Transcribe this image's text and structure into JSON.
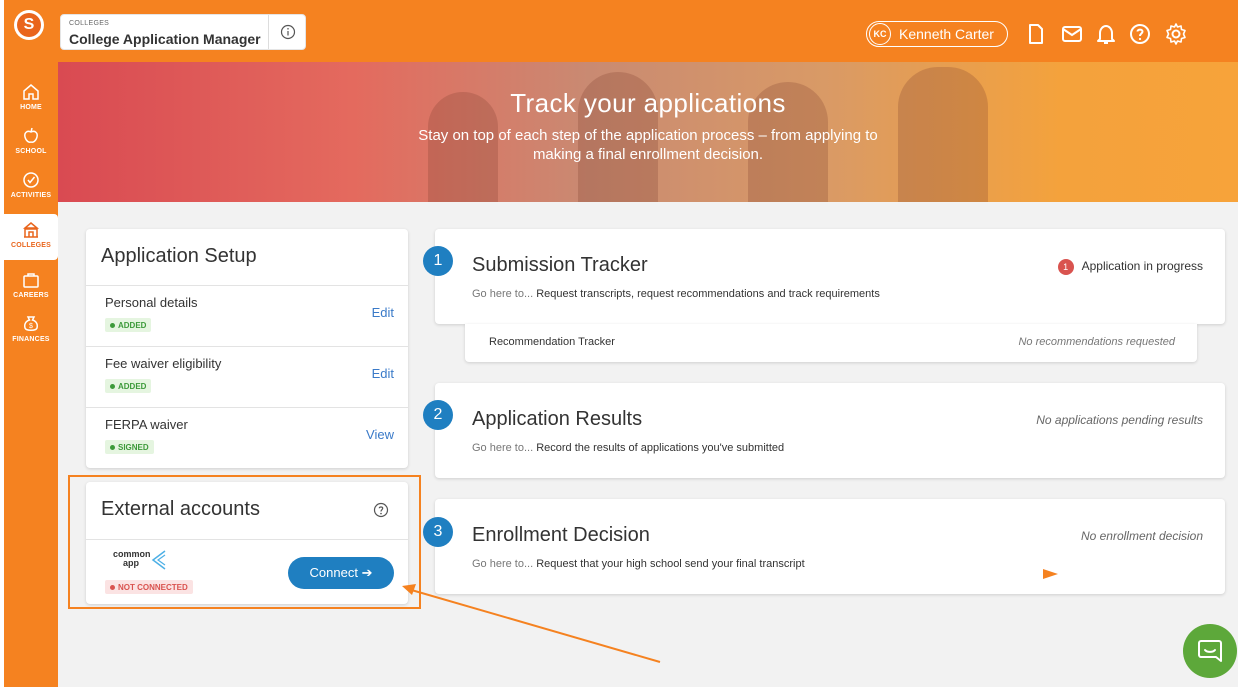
{
  "rail": {
    "logo": "S",
    "items": [
      {
        "label": "HOME",
        "icon": "home-icon"
      },
      {
        "label": "SCHOOL",
        "icon": "apple-icon"
      },
      {
        "label": "ACTIVITIES",
        "icon": "check-circle-icon"
      },
      {
        "label": "COLLEGES",
        "icon": "college-icon"
      },
      {
        "label": "CAREERS",
        "icon": "briefcase-icon"
      },
      {
        "label": "FINANCES",
        "icon": "money-bag-icon"
      }
    ]
  },
  "header": {
    "section_label": "COLLEGES",
    "title": "College Application Manager",
    "user_initials": "KC",
    "user_name": "Kenneth Carter"
  },
  "hero": {
    "title": "Track your applications",
    "subtitle": "Stay on top of each step of the application process – from applying to making a final enrollment decision."
  },
  "setup": {
    "title": "Application Setup",
    "rows": [
      {
        "label": "Personal details",
        "badge": "ADDED",
        "action": "Edit"
      },
      {
        "label": "Fee waiver eligibility",
        "badge": "ADDED",
        "action": "Edit"
      },
      {
        "label": "FERPA waiver",
        "badge": "SIGNED",
        "action": "View"
      }
    ]
  },
  "external": {
    "title": "External accounts",
    "logo_line1": "common",
    "logo_line2": "app",
    "badge": "NOT CONNECTED",
    "connect": "Connect ➔"
  },
  "trackers": [
    {
      "num": "1",
      "title": "Submission Tracker",
      "prefix": "Go here to...",
      "desc": "Request transcripts, request recommendations and track requirements",
      "count": "1",
      "status": "Application in progress"
    },
    {
      "num": "2",
      "title": "Application Results",
      "prefix": "Go here to...",
      "desc": "Record the results of applications you've submitted",
      "status": "No applications pending results"
    },
    {
      "num": "3",
      "title": "Enrollment Decision",
      "prefix": "Go here to...",
      "desc": "Request that your high school send your final transcript",
      "status": "No enrollment decision"
    }
  ],
  "recommendation": {
    "label": "Recommendation Tracker",
    "status": "No recommendations requested"
  },
  "colors": {
    "brand_orange": "#f58220",
    "primary_blue": "#1f7fc1",
    "success_green": "#3d9a3a",
    "error_red": "#d9534f",
    "chat_green": "#5da83a"
  }
}
